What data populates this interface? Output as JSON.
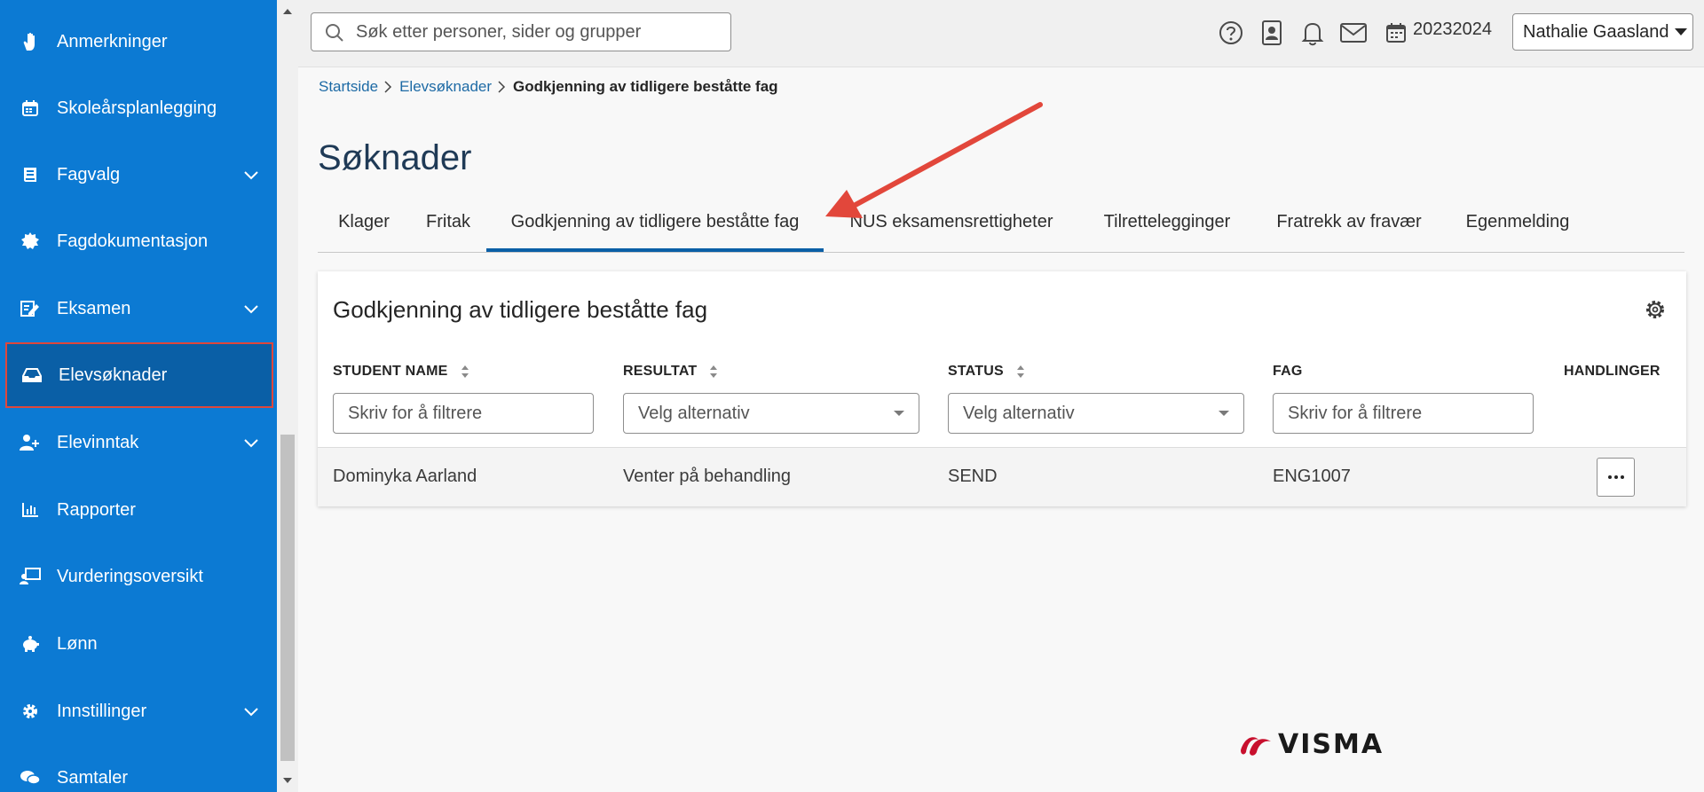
{
  "sidebar": {
    "items": [
      {
        "label": "Anmerkninger",
        "icon": "hand-icon",
        "has_chevron": false
      },
      {
        "label": "Skoleårsplanlegging",
        "icon": "calendar-icon",
        "has_chevron": false
      },
      {
        "label": "Fagvalg",
        "icon": "book-icon",
        "has_chevron": true
      },
      {
        "label": "Fagdokumentasjon",
        "icon": "badge-icon",
        "has_chevron": false
      },
      {
        "label": "Eksamen",
        "icon": "exam-edit-icon",
        "has_chevron": true
      },
      {
        "label": "Elevsøknader",
        "icon": "inbox-icon",
        "has_chevron": false,
        "active": true
      },
      {
        "label": "Elevinntak",
        "icon": "user-add-icon",
        "has_chevron": true
      },
      {
        "label": "Rapporter",
        "icon": "bar-chart-icon",
        "has_chevron": false
      },
      {
        "label": "Vurderingsoversikt",
        "icon": "presentation-icon",
        "has_chevron": false
      },
      {
        "label": "Lønn",
        "icon": "piggy-bank-icon",
        "has_chevron": false
      },
      {
        "label": "Innstillinger",
        "icon": "gear-icon",
        "has_chevron": true
      },
      {
        "label": "Samtaler",
        "icon": "chat-icon",
        "has_chevron": false
      }
    ]
  },
  "topbar": {
    "search_placeholder": "Søk etter personer, sider og grupper",
    "school_year": "20232024",
    "user_name": "Nathalie Gaasland"
  },
  "breadcrumb": {
    "items": [
      "Startside",
      "Elevsøknader"
    ],
    "current": "Godkjenning av tidligere beståtte fag"
  },
  "page": {
    "title": "Søknader"
  },
  "tabs": [
    {
      "label": "Klager"
    },
    {
      "label": "Fritak"
    },
    {
      "label": "Godkjenning av tidligere beståtte fag",
      "active": true
    },
    {
      "label": "NUS eksamensrettigheter"
    },
    {
      "label": "Tilrettelegginger"
    },
    {
      "label": "Fratrekk av fravær"
    },
    {
      "label": "Egenmelding"
    }
  ],
  "card": {
    "title": "Godkjenning av tidligere beståtte fag",
    "columns": {
      "student_name": "STUDENT NAME",
      "resultat": "RESULTAT",
      "status": "STATUS",
      "fag": "FAG",
      "handlinger": "HANDLINGER"
    },
    "filters": {
      "student_name_placeholder": "Skriv for å filtrere",
      "resultat_placeholder": "Velg alternativ",
      "status_placeholder": "Velg alternativ",
      "fag_placeholder": "Skriv for å filtrere"
    },
    "rows": [
      {
        "student_name": "Dominyka Aarland",
        "resultat": "Venter på behandling",
        "status": "SEND",
        "fag": "ENG1007"
      }
    ]
  },
  "footer": {
    "logo_text": "VISMA"
  },
  "colors": {
    "sidebar_bg": "#0c7ad3",
    "sidebar_active_bg": "#0a5fa6",
    "highlight_border": "#e0473b",
    "annotation_arrow": "#e2473b",
    "tab_active_underline": "#0a5fa6",
    "logo_red": "#c8102e"
  }
}
